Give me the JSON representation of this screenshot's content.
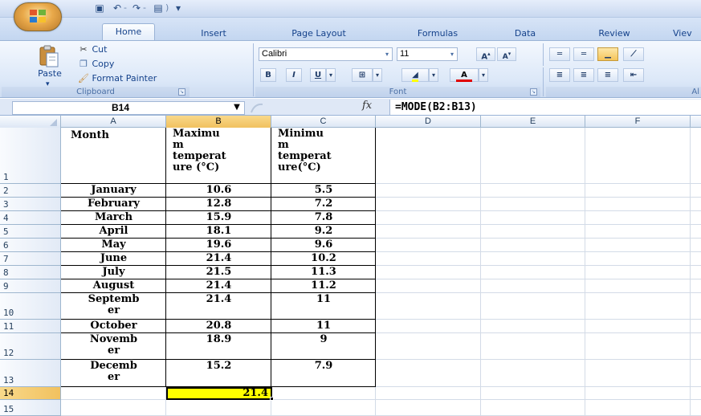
{
  "quick_access": {
    "save_icon": "save-icon",
    "undo_icon": "undo-icon",
    "redo_icon": "redo-icon",
    "print_icon": "print-icon",
    "customize_icon": "customize-qat-icon"
  },
  "tabs": [
    "Home",
    "Insert",
    "Page Layout",
    "Formulas",
    "Data",
    "Review",
    "Viev"
  ],
  "clipboard": {
    "paste_label": "Paste",
    "cut_label": "Cut",
    "copy_label": "Copy",
    "format_painter_label": "Format Painter",
    "group_title": "Clipboard"
  },
  "font": {
    "font_name": "Calibri",
    "font_size": "11",
    "group_title": "Font",
    "grow_label": "A",
    "shrink_label": "A",
    "bold_label": "B",
    "italic_label": "I",
    "underline_label": "U",
    "font_color_label": "A"
  },
  "alignment": {
    "group_title": "Al"
  },
  "formula_bar": {
    "name_box": "B14",
    "fx_label": "fx",
    "formula": "=MODE(B2:B13)"
  },
  "columns": [
    "A",
    "B",
    "C",
    "D",
    "E",
    "F"
  ],
  "row_numbers": [
    "1",
    "2",
    "3",
    "4",
    "5",
    "6",
    "7",
    "8",
    "9",
    "10",
    "11",
    "12",
    "13",
    "14",
    "15"
  ],
  "header_row": {
    "a": "Month",
    "b_lines": [
      "Maximu",
      "m",
      "temperat",
      "ure (°C)"
    ],
    "c_lines": [
      "Minimu",
      "m",
      "temperat",
      "ure(°C)"
    ]
  },
  "rows": [
    {
      "month": [
        "January"
      ],
      "max": "10.6",
      "min": "5.5"
    },
    {
      "month": [
        "February"
      ],
      "max": "12.8",
      "min": "7.2"
    },
    {
      "month": [
        "March"
      ],
      "max": "15.9",
      "min": "7.8"
    },
    {
      "month": [
        "April"
      ],
      "max": "18.1",
      "min": "9.2"
    },
    {
      "month": [
        "May"
      ],
      "max": "19.6",
      "min": "9.6"
    },
    {
      "month": [
        "June"
      ],
      "max": "21.4",
      "min": "10.2"
    },
    {
      "month": [
        "July"
      ],
      "max": "21.5",
      "min": "11.3"
    },
    {
      "month": [
        "August"
      ],
      "max": "21.4",
      "min": "11.2"
    },
    {
      "month": [
        "Septemb",
        "er"
      ],
      "max": "21.4",
      "min": "11"
    },
    {
      "month": [
        "October"
      ],
      "max": "20.8",
      "min": "11"
    },
    {
      "month": [
        "Novemb",
        "er"
      ],
      "max": "18.9",
      "min": "9"
    },
    {
      "month": [
        "Decemb",
        "er"
      ],
      "max": "15.2",
      "min": "7.9"
    }
  ],
  "result_cell": {
    "address": "B14",
    "value": "21.4",
    "fill_color": "#ffff00"
  },
  "colors": {
    "ribbon_text": "#15428b",
    "selected_header": "#f1c15f"
  }
}
